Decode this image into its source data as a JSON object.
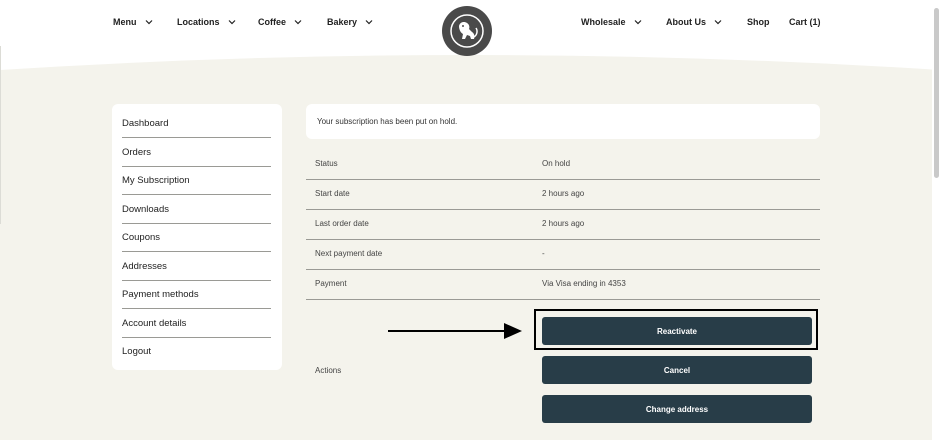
{
  "nav": {
    "left": [
      {
        "label": "Menu",
        "dropdown": true
      },
      {
        "label": "Locations",
        "dropdown": true
      },
      {
        "label": "Coffee",
        "dropdown": true
      },
      {
        "label": "Bakery",
        "dropdown": true
      }
    ],
    "right": [
      {
        "label": "Wholesale",
        "dropdown": true
      },
      {
        "label": "About Us",
        "dropdown": true
      },
      {
        "label": "Shop",
        "dropdown": false
      },
      {
        "label": "Cart (1)",
        "dropdown": false
      }
    ],
    "logo_icon": "monkey-logo-icon"
  },
  "sidebar": {
    "items": [
      {
        "label": "Dashboard"
      },
      {
        "label": "Orders"
      },
      {
        "label": "My Subscription"
      },
      {
        "label": "Downloads"
      },
      {
        "label": "Coupons"
      },
      {
        "label": "Addresses"
      },
      {
        "label": "Payment methods"
      },
      {
        "label": "Account details"
      },
      {
        "label": "Logout"
      }
    ]
  },
  "notice": "Your subscription has been put on hold.",
  "details": [
    {
      "label": "Status",
      "value": "On hold"
    },
    {
      "label": "Start date",
      "value": "2 hours ago"
    },
    {
      "label": "Last order date",
      "value": "2 hours ago"
    },
    {
      "label": "Next payment date",
      "value": "-"
    },
    {
      "label": "Payment",
      "value": "Via Visa ending in 4353"
    }
  ],
  "actions": {
    "label": "Actions",
    "buttons": [
      {
        "label": "Reactivate"
      },
      {
        "label": "Cancel"
      },
      {
        "label": "Change address"
      }
    ]
  },
  "colors": {
    "page_bg": "#f4f3ec",
    "button_bg": "#283d48",
    "logo_bg": "#4a4a4a"
  }
}
